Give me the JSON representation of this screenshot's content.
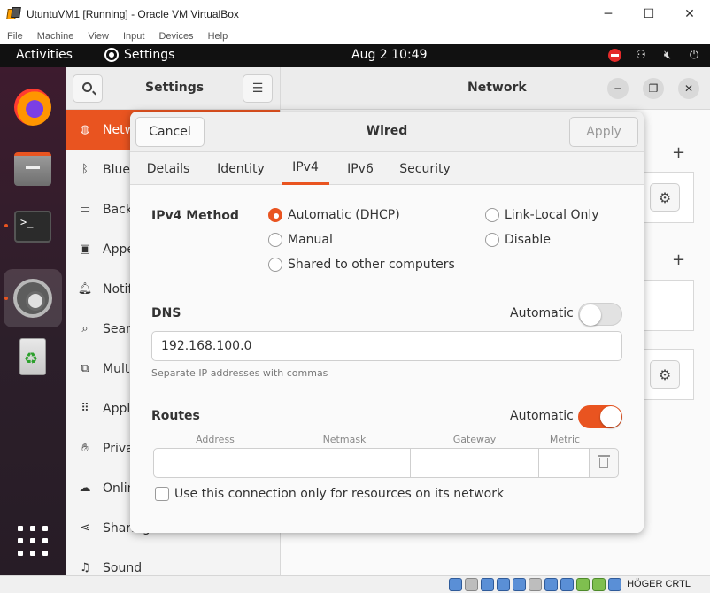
{
  "vbox": {
    "title": "UtuntuVM1 [Running] - Oracle VM VirtualBox",
    "menu": [
      "File",
      "Machine",
      "View",
      "Input",
      "Devices",
      "Help"
    ],
    "host_key": "HÖGER CRTL"
  },
  "topbar": {
    "activities": "Activities",
    "app_name": "Settings",
    "clock": "Aug 2  10:49"
  },
  "settings": {
    "sidebar_title": "Settings",
    "panel_title": "Network",
    "sidebar_items": [
      {
        "label": "Network",
        "icon": "network-icon"
      },
      {
        "label": "Bluetooth",
        "icon": "bluetooth-icon"
      },
      {
        "label": "Background",
        "icon": "background-icon"
      },
      {
        "label": "Appearance",
        "icon": "appearance-icon"
      },
      {
        "label": "Notifications",
        "icon": "bell-icon"
      },
      {
        "label": "Search",
        "icon": "search-icon"
      },
      {
        "label": "Multitasking",
        "icon": "multitasking-icon"
      },
      {
        "label": "Applications",
        "icon": "grid-icon"
      },
      {
        "label": "Privacy",
        "icon": "privacy-icon"
      },
      {
        "label": "Online Accounts",
        "icon": "cloud-icon"
      },
      {
        "label": "Sharing",
        "icon": "share-icon"
      },
      {
        "label": "Sound",
        "icon": "music-icon"
      }
    ]
  },
  "dialog": {
    "title": "Wired",
    "cancel": "Cancel",
    "apply": "Apply",
    "tabs": [
      "Details",
      "Identity",
      "IPv4",
      "IPv6",
      "Security"
    ],
    "active_tab": "IPv4",
    "ipv4_method_label": "IPv4 Method",
    "methods": {
      "automatic": "Automatic (DHCP)",
      "link_local": "Link-Local Only",
      "manual": "Manual",
      "disable": "Disable",
      "shared": "Shared to other computers"
    },
    "selected_method": "Automatic (DHCP)",
    "dns": {
      "label": "DNS",
      "automatic_label": "Automatic",
      "automatic_on": false,
      "value": "192.168.100.0",
      "hint": "Separate IP addresses with commas"
    },
    "routes": {
      "label": "Routes",
      "automatic_label": "Automatic",
      "automatic_on": true,
      "columns": [
        "Address",
        "Netmask",
        "Gateway",
        "Metric"
      ]
    },
    "only_local_label": "Use this connection only for resources on its network",
    "only_local_checked": false
  },
  "colors": {
    "accent": "#e95420",
    "topbar": "#111111"
  }
}
